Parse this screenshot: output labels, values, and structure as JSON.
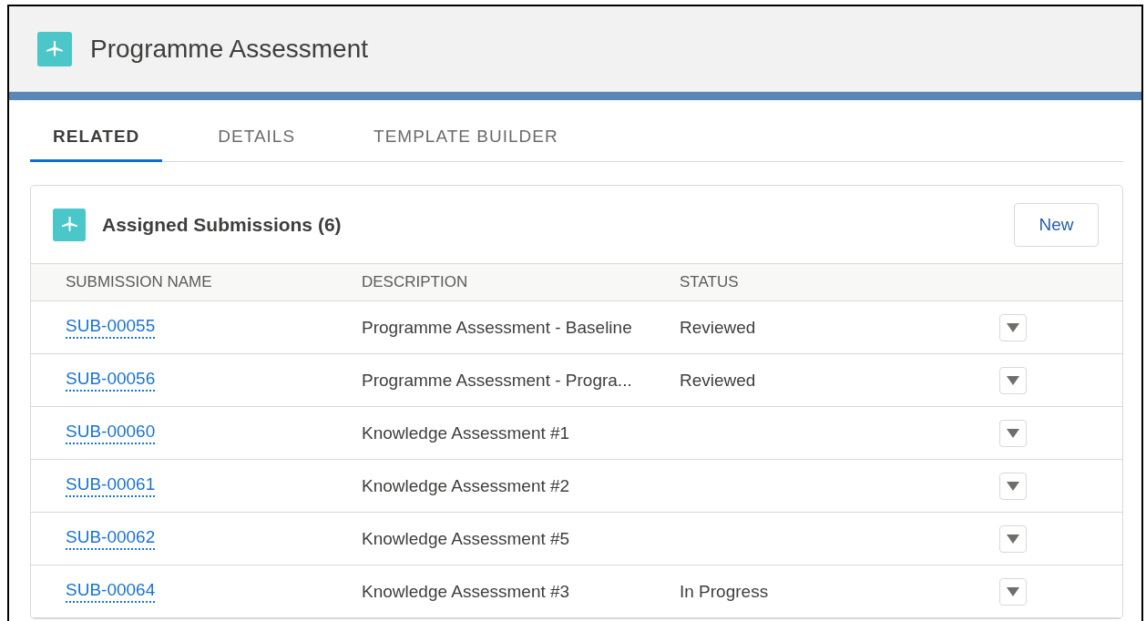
{
  "header": {
    "title": "Programme Assessment"
  },
  "tabs": [
    {
      "label": "RELATED",
      "selected": true
    },
    {
      "label": "DETAILS",
      "selected": false
    },
    {
      "label": "TEMPLATE BUILDER",
      "selected": false
    }
  ],
  "card": {
    "title": "Assigned Submissions (6)",
    "button": "New",
    "columns": [
      "SUBMISSION NAME",
      "DESCRIPTION",
      "STATUS"
    ],
    "rows": [
      {
        "name": "SUB-00055",
        "description": "Programme Assessment - Baseline",
        "status": "Reviewed"
      },
      {
        "name": "SUB-00056",
        "description": "Programme Assessment - Progra...",
        "status": "Reviewed"
      },
      {
        "name": "SUB-00060",
        "description": "Knowledge Assessment #1"
      },
      {
        "name": "SUB-00061",
        "description": "Knowledge Assessment #2"
      },
      {
        "name": "SUB-00062",
        "description": "Knowledge Assessment #5"
      },
      {
        "name": "SUB-00064",
        "description": "Knowledge Assessment #3",
        "status": "In Progress"
      }
    ]
  }
}
